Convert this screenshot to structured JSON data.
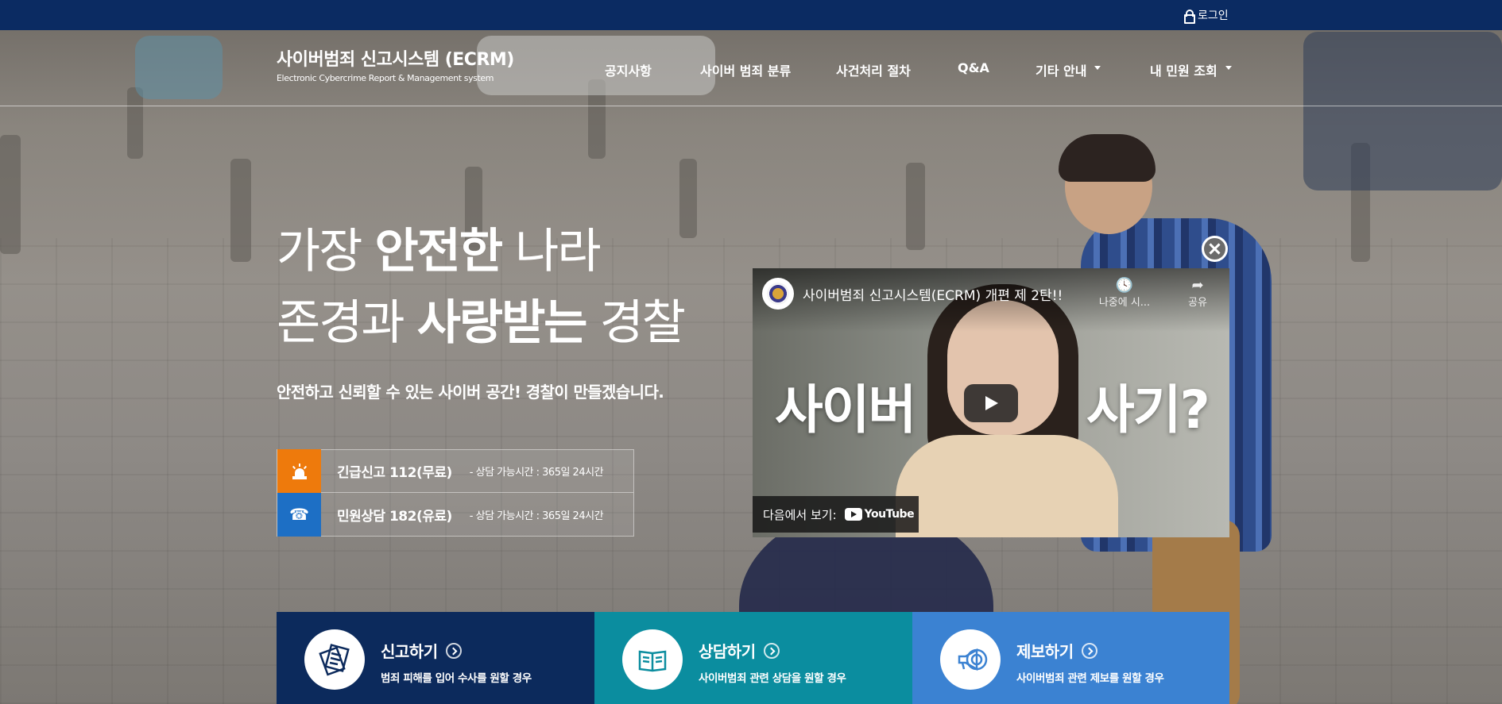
{
  "topbar": {
    "login_label": "로그인"
  },
  "logo": {
    "title": "사이버범죄 신고시스템 (ECRM)",
    "subtitle": "Electronic Cybercrime Report & Management system"
  },
  "nav": {
    "items": [
      {
        "label": "공지사항"
      },
      {
        "label": "사이버 범죄 분류"
      },
      {
        "label": "사건처리 절차"
      },
      {
        "label": "Q&A"
      },
      {
        "label": "기타 안내"
      },
      {
        "label": "내 민원 조회"
      }
    ]
  },
  "hero": {
    "line1_pre": "가장 ",
    "line1_bold": "안전한",
    "line1_post": " 나라",
    "line2_pre": "존경과 ",
    "line2_bold": "사랑받는",
    "line2_post": " 경찰",
    "tagline": "안전하고 신뢰할 수 있는 사이버 공간! 경찰이 만들겠습니다."
  },
  "contacts": [
    {
      "title": "긴급신고 112(무료)",
      "hours": "- 상담 가능시간 : 365일 24시간",
      "icon": "siren-icon",
      "color": "#ee7a0c"
    },
    {
      "title": "민원상담 182(유료)",
      "hours": "- 상담 가능시간 : 365일 24시간",
      "icon": "phone-icon",
      "color": "#1d6fc5"
    }
  ],
  "video": {
    "title": "사이버범죄 신고시스템(ECRM) 개편 제 2탄!!",
    "watch_later": "나중에 시...",
    "share": "공유",
    "overlay_left": "사이버",
    "overlay_right": "사기?",
    "watch_on": "다음에서 보기:",
    "youtube": "YouTube"
  },
  "services": [
    {
      "title": "신고하기",
      "desc": "범죄 피해를 입어 수사를 원할 경우",
      "icon": "report-document-icon",
      "color": "#0c2a5c"
    },
    {
      "title": "상담하기",
      "desc": "사이버범죄 관련 상담을 원할 경우",
      "icon": "counsel-book-icon",
      "color": "#0b8d9f"
    },
    {
      "title": "제보하기",
      "desc": "사이버범죄 관련 제보를 원할 경우",
      "icon": "tip-megaphone-icon",
      "color": "#3b82d2"
    }
  ]
}
